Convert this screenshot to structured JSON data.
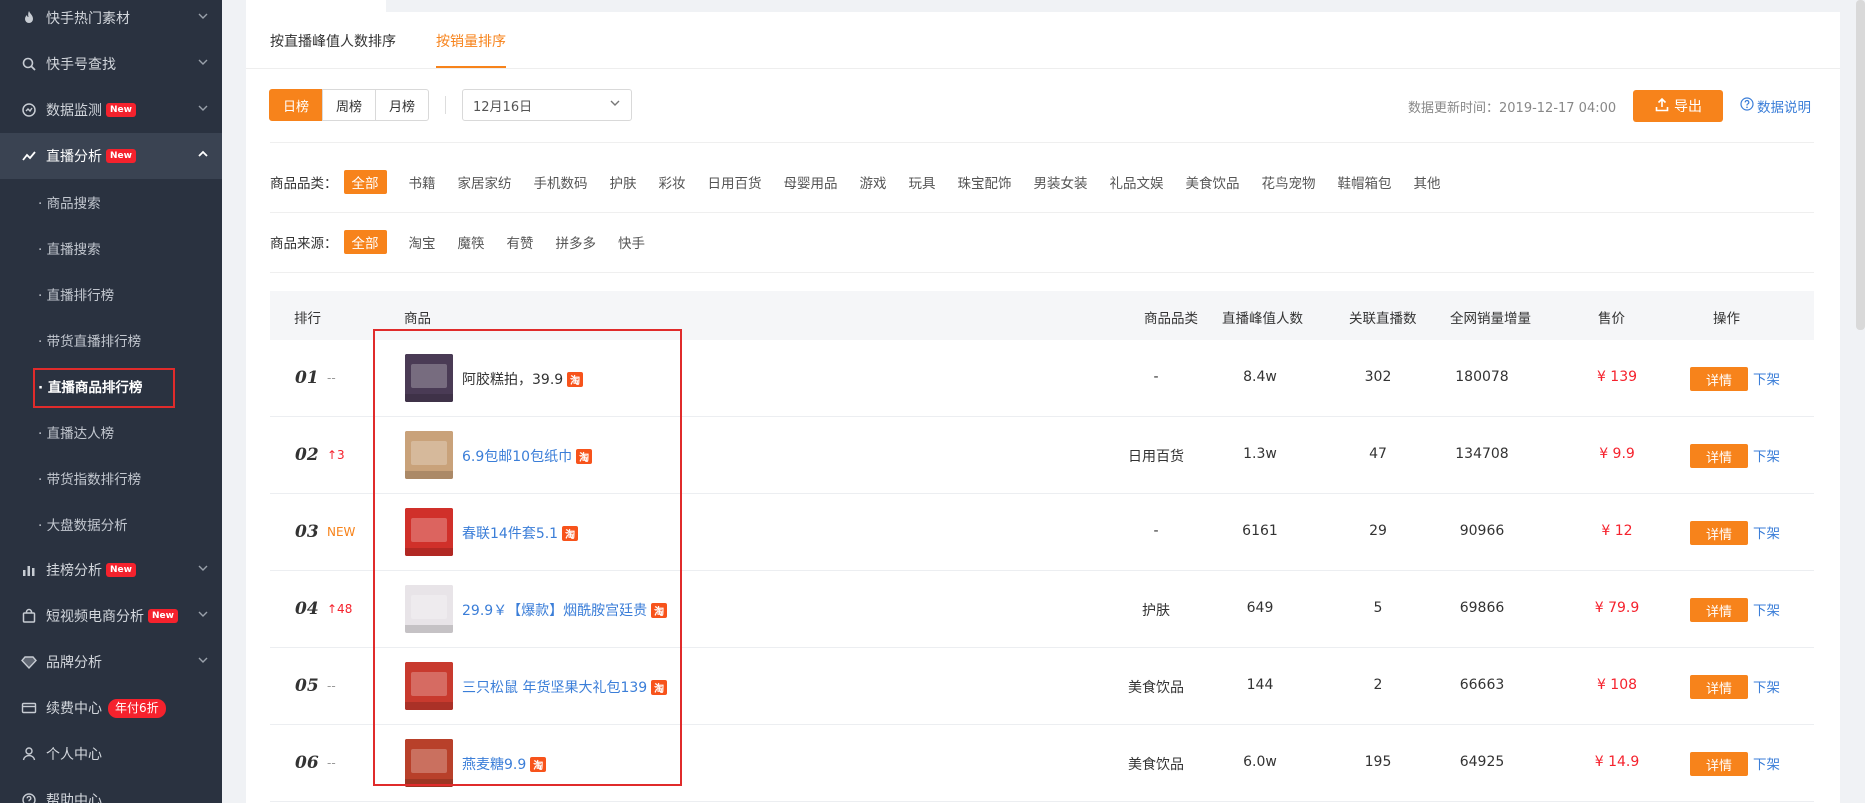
{
  "sidebar": {
    "items": [
      {
        "label": "快手热门素材",
        "icon": "fire-icon",
        "new": false
      },
      {
        "label": "快手号查找",
        "icon": "search-icon",
        "new": false
      },
      {
        "label": "数据监测",
        "icon": "monitor-icon",
        "new": true
      },
      {
        "label": "直播分析",
        "icon": "chart-line-icon",
        "new": true,
        "active": true
      },
      {
        "label": "挂榜分析",
        "icon": "bar-chart-icon",
        "new": true
      },
      {
        "label": "短视频电商分析",
        "icon": "shopping-bag-icon",
        "new": true
      },
      {
        "label": "品牌分析",
        "icon": "diamond-icon",
        "new": false
      },
      {
        "label": "续费中心",
        "icon": "card-icon",
        "deal": "年付6折"
      },
      {
        "label": "个人中心",
        "icon": "user-icon"
      },
      {
        "label": "帮助中心",
        "icon": "help-icon"
      }
    ],
    "new_badge": "New",
    "sub_items": [
      "· 商品搜索",
      "· 直播搜索",
      "· 直播排行榜",
      "· 带货直播排行榜",
      "· 直播商品排行榜",
      "· 直播达人榜",
      "· 带货指数排行榜",
      "· 大盘数据分析"
    ]
  },
  "tabs": [
    "按直播峰值人数排序",
    "按销量排序"
  ],
  "toolbar": {
    "periods": [
      "日榜",
      "周榜",
      "月榜"
    ],
    "date": "12月16日",
    "update_time": "数据更新时间：2019-12-17 04:00",
    "export_label": "导出",
    "note_label": "数据说明"
  },
  "filters": {
    "category_label": "商品品类：",
    "categories": [
      "全部",
      "书籍",
      "家居家纺",
      "手机数码",
      "护肤",
      "彩妆",
      "日用百货",
      "母婴用品",
      "游戏",
      "玩具",
      "珠宝配饰",
      "男装女装",
      "礼品文娱",
      "美食饮品",
      "花鸟宠物",
      "鞋帽箱包",
      "其他"
    ],
    "source_label": "商品来源：",
    "sources": [
      "全部",
      "淘宝",
      "魔筷",
      "有赞",
      "拼多多",
      "快手"
    ]
  },
  "table": {
    "headers": [
      "排行",
      "商品",
      "商品品类",
      "直播峰值人数",
      "关联直播数",
      "全网销量增量",
      "售价",
      "操作"
    ],
    "taobao_glyph": "淘",
    "detail_label": "详情",
    "offline_label": "下架",
    "rows": [
      {
        "rank": "01",
        "trend": "--",
        "trend_type": "flat",
        "name": "阿胶糕拍，39.9",
        "category": "-",
        "peak": "8.4w",
        "lives": "302",
        "sales": "180078",
        "price": "¥ 139",
        "thumb": "#4a3b55"
      },
      {
        "rank": "02",
        "trend": "↑3",
        "trend_type": "up",
        "name": "6.9包邮10包纸巾",
        "category": "日用百货",
        "peak": "1.3w",
        "lives": "47",
        "sales": "134708",
        "price": "¥ 9.9",
        "thumb": "#c9a27a"
      },
      {
        "rank": "03",
        "trend": "NEW",
        "trend_type": "new",
        "name": "春联14件套5.1",
        "category": "-",
        "peak": "6161",
        "lives": "29",
        "sales": "90966",
        "price": "¥ 12",
        "thumb": "#d0302a"
      },
      {
        "rank": "04",
        "trend": "↑48",
        "trend_type": "up",
        "name": "29.9￥【爆款】烟酰胺宫廷贵",
        "category": "护肤",
        "peak": "649",
        "lives": "5",
        "sales": "69866",
        "price": "¥ 79.9",
        "thumb": "#e8e4e8"
      },
      {
        "rank": "05",
        "trend": "--",
        "trend_type": "flat",
        "name": "三只松鼠 年货坚果大礼包139",
        "category": "美食饮品",
        "peak": "144",
        "lives": "2",
        "sales": "66663",
        "price": "¥ 108",
        "thumb": "#c83a2e"
      },
      {
        "rank": "06",
        "trend": "--",
        "trend_type": "flat",
        "name": "燕麦糖9.9",
        "category": "美食饮品",
        "peak": "6.0w",
        "lives": "195",
        "sales": "64925",
        "price": "¥ 14.9",
        "thumb": "#b8402a"
      }
    ]
  }
}
